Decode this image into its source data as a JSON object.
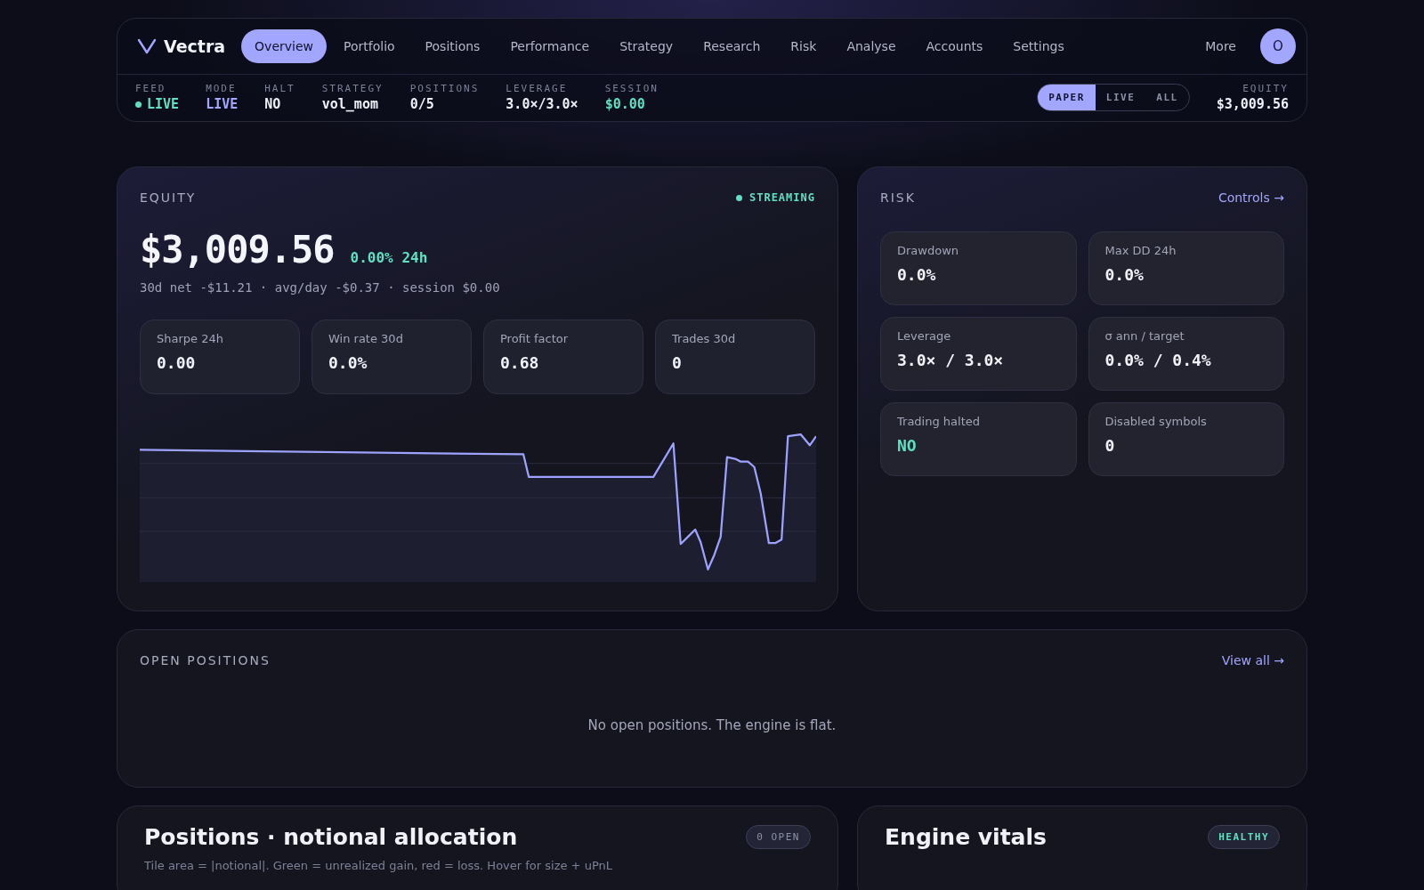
{
  "nav": {
    "brand": "Vectra",
    "tabs": [
      {
        "label": "Overview",
        "selected": true
      },
      {
        "label": "Portfolio",
        "selected": false
      },
      {
        "label": "Positions",
        "selected": false
      },
      {
        "label": "Performance",
        "selected": false
      },
      {
        "label": "Strategy",
        "selected": false
      },
      {
        "label": "Research",
        "selected": false
      },
      {
        "label": "Risk",
        "selected": false
      },
      {
        "label": "Analyse",
        "selected": false
      },
      {
        "label": "Accounts",
        "selected": false
      },
      {
        "label": "Settings",
        "selected": false
      }
    ],
    "more": "More",
    "avatar": "O"
  },
  "status_bar": {
    "items": [
      {
        "label": "FEED",
        "value": "LIVE",
        "kind": "live"
      },
      {
        "label": "MODE",
        "value": "LIVE",
        "kind": "accent"
      },
      {
        "label": "HALT",
        "value": "NO",
        "kind": "plain"
      },
      {
        "label": "STRATEGY",
        "value": "vol_mom",
        "kind": "plain"
      },
      {
        "label": "POSITIONS",
        "value": "0/5",
        "kind": "plain"
      },
      {
        "label": "LEVERAGE",
        "value": "3.0×/3.0×",
        "kind": "plain"
      },
      {
        "label": "SESSION",
        "value": "$0.00",
        "kind": "positive"
      }
    ],
    "modes": [
      {
        "label": "PAPER",
        "selected": true
      },
      {
        "label": "LIVE",
        "selected": false
      },
      {
        "label": "ALL",
        "selected": false
      }
    ],
    "equity": {
      "label": "EQUITY",
      "value": "$3,009.56"
    }
  },
  "equity_card": {
    "title": "EQUITY",
    "status": "STREAMING",
    "value": "$3,009.56",
    "change": "0.00% 24h",
    "subline": "30d net -$11.21 · avg/day -$0.37 · session $0.00",
    "stats": [
      {
        "label": "Sharpe 24h",
        "value": "0.00"
      },
      {
        "label": "Win rate 30d",
        "value": "0.0%"
      },
      {
        "label": "Profit factor",
        "value": "0.68"
      },
      {
        "label": "Trades 30d",
        "value": "0"
      }
    ]
  },
  "risk_card": {
    "title": "RISK",
    "link": "Controls →",
    "stats": [
      {
        "label": "Drawdown",
        "value": "0.0%",
        "positive": false
      },
      {
        "label": "Max DD 24h",
        "value": "0.0%",
        "positive": false
      },
      {
        "label": "Leverage",
        "value": "3.0× / 3.0×",
        "positive": false
      },
      {
        "label": "σ ann / target",
        "value": "0.0% / 0.4%",
        "positive": false
      },
      {
        "label": "Trading halted",
        "value": "NO",
        "positive": true
      },
      {
        "label": "Disabled symbols",
        "value": "0",
        "positive": false
      }
    ]
  },
  "open_positions": {
    "title": "OPEN POSITIONS",
    "link": "View all →",
    "empty": "No open positions. The engine is flat."
  },
  "allocation": {
    "title": "Positions · notional allocation",
    "badge": "0 OPEN",
    "caption": "Tile area = |notional|. Green = unrealized gain, red = loss. Hover for size + uPnL"
  },
  "vitals": {
    "title": "Engine vitals",
    "badge": "HEALTHY"
  }
}
